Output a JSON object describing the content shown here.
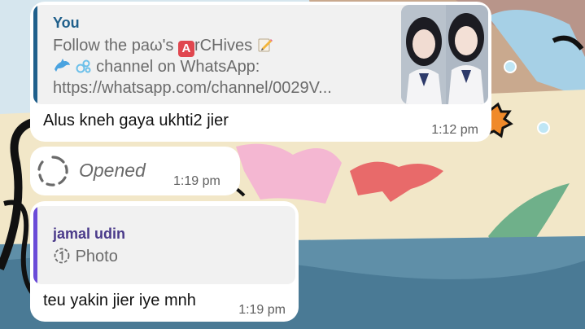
{
  "messages": [
    {
      "reply_sender": "You",
      "reply_line1_text": "Follow the paω's",
      "reply_emoji_letter": "A",
      "reply_line1_rest": "rCHives",
      "reply_pencil_icon": "memo-icon",
      "reply_line2_icons": [
        "dolphin-icon",
        "bubbles-icon"
      ],
      "reply_line2_text": "channel on WhatsApp:",
      "reply_line3_text": "https://whatsapp.com/channel/0029V...",
      "text": "Alus kneh gaya ukhti2 jier",
      "time": "1:12 pm"
    },
    {
      "status_icon": "view-once-icon",
      "text": "Opened",
      "time": "1:19 pm"
    },
    {
      "reply_sender": "jamal udin",
      "reply_icon": "view-once-photo-icon",
      "reply_text": "Photo",
      "text": "teu yakin jier iye mnh",
      "time": "1:19 pm"
    }
  ],
  "colors": {
    "you_accent": "#1f5f8b",
    "jamal_accent": "#6a4bd8",
    "jamal_name": "#4a3a8a"
  }
}
